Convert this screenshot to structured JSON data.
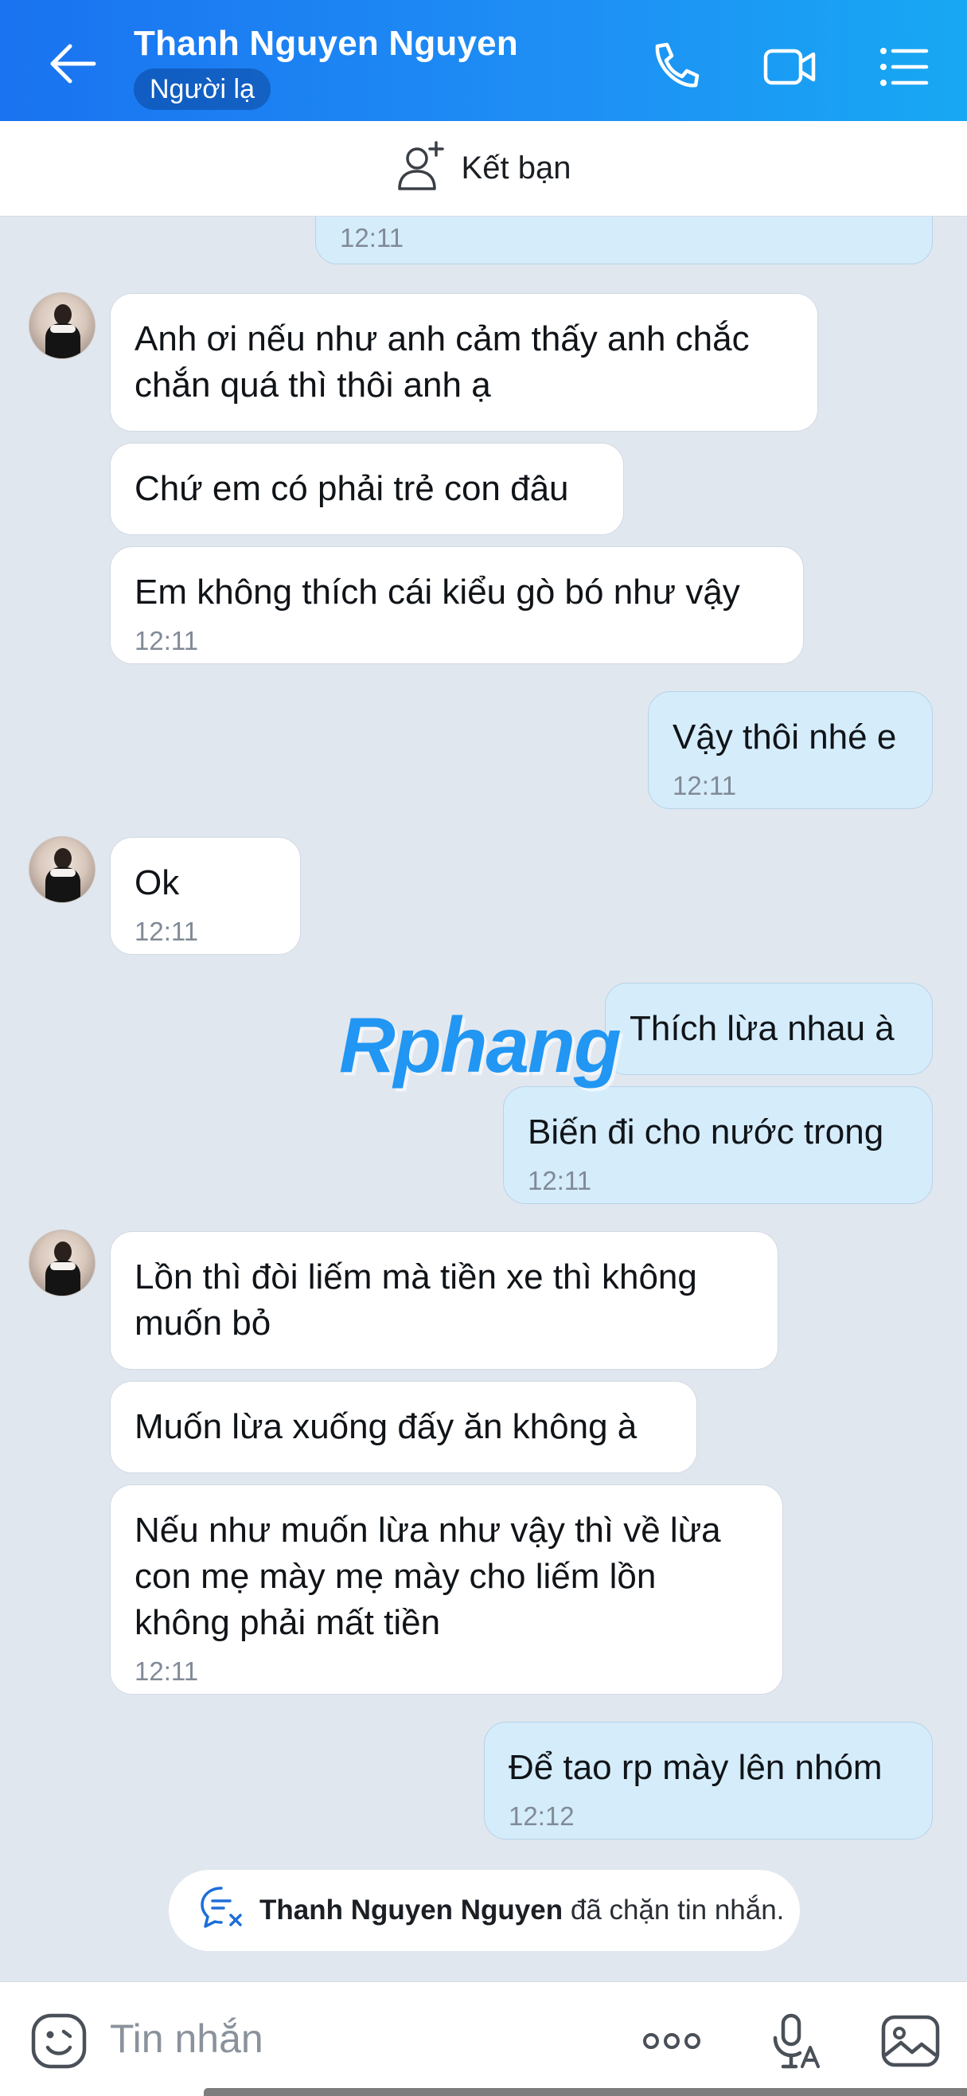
{
  "header": {
    "title": "Thanh Nguyen Nguyen",
    "badge": "Người lạ",
    "icons": [
      "back-arrow-icon",
      "phone-icon",
      "video-call-icon",
      "menu-list-icon"
    ]
  },
  "friend_bar": {
    "label": "Kết bạn",
    "icon": "add-user-icon"
  },
  "messages": [
    {
      "dir": "out",
      "text": "",
      "time": "12:11"
    },
    {
      "dir": "in",
      "text": "Anh ơi nếu như anh cảm thấy anh chắc chắn quá thì thôi anh ạ",
      "time": ""
    },
    {
      "dir": "in",
      "text": "Chứ em có phải trẻ con đâu",
      "time": ""
    },
    {
      "dir": "in",
      "text": "Em không thích cái kiểu gò bó như vậy",
      "time": "12:11"
    },
    {
      "dir": "out",
      "text": "Vậy thôi nhé e",
      "time": "12:11"
    },
    {
      "dir": "in",
      "text": "Ok",
      "time": "12:11"
    },
    {
      "dir": "out",
      "text": "Thích lừa nhau à",
      "time": ""
    },
    {
      "dir": "out",
      "text": "Biến đi cho nước trong",
      "time": "12:11"
    },
    {
      "dir": "in",
      "text": "Lồn thì đòi liếm mà tiền xe thì không muốn bỏ",
      "time": ""
    },
    {
      "dir": "in",
      "text": "Muốn lừa xuống đấy ăn không à",
      "time": ""
    },
    {
      "dir": "in",
      "text": "Nếu như muốn lừa như vậy thì về lừa con mẹ mày mẹ mày cho liếm lồn không phải mất tiền",
      "time": "12:11"
    },
    {
      "dir": "out",
      "text": "Để tao rp mày lên nhóm",
      "time": "12:12"
    }
  ],
  "watermark": "Rphang",
  "notice": {
    "name": "Thanh Nguyen Nguyen",
    "text": " đã chặn tin nhắn.",
    "icon": "blocked-chat-icon"
  },
  "input": {
    "placeholder": "Tin nhắn",
    "icons": [
      "sticker-icon",
      "more-icon",
      "voice-to-text-icon",
      "image-icon"
    ]
  },
  "colors": {
    "header_start": "#1a73f0",
    "header_end": "#17a8f3",
    "chat_background": "#e1e7ef",
    "incoming_bubble": "#ffffff",
    "outgoing_bubble": "#d5ecfb"
  }
}
